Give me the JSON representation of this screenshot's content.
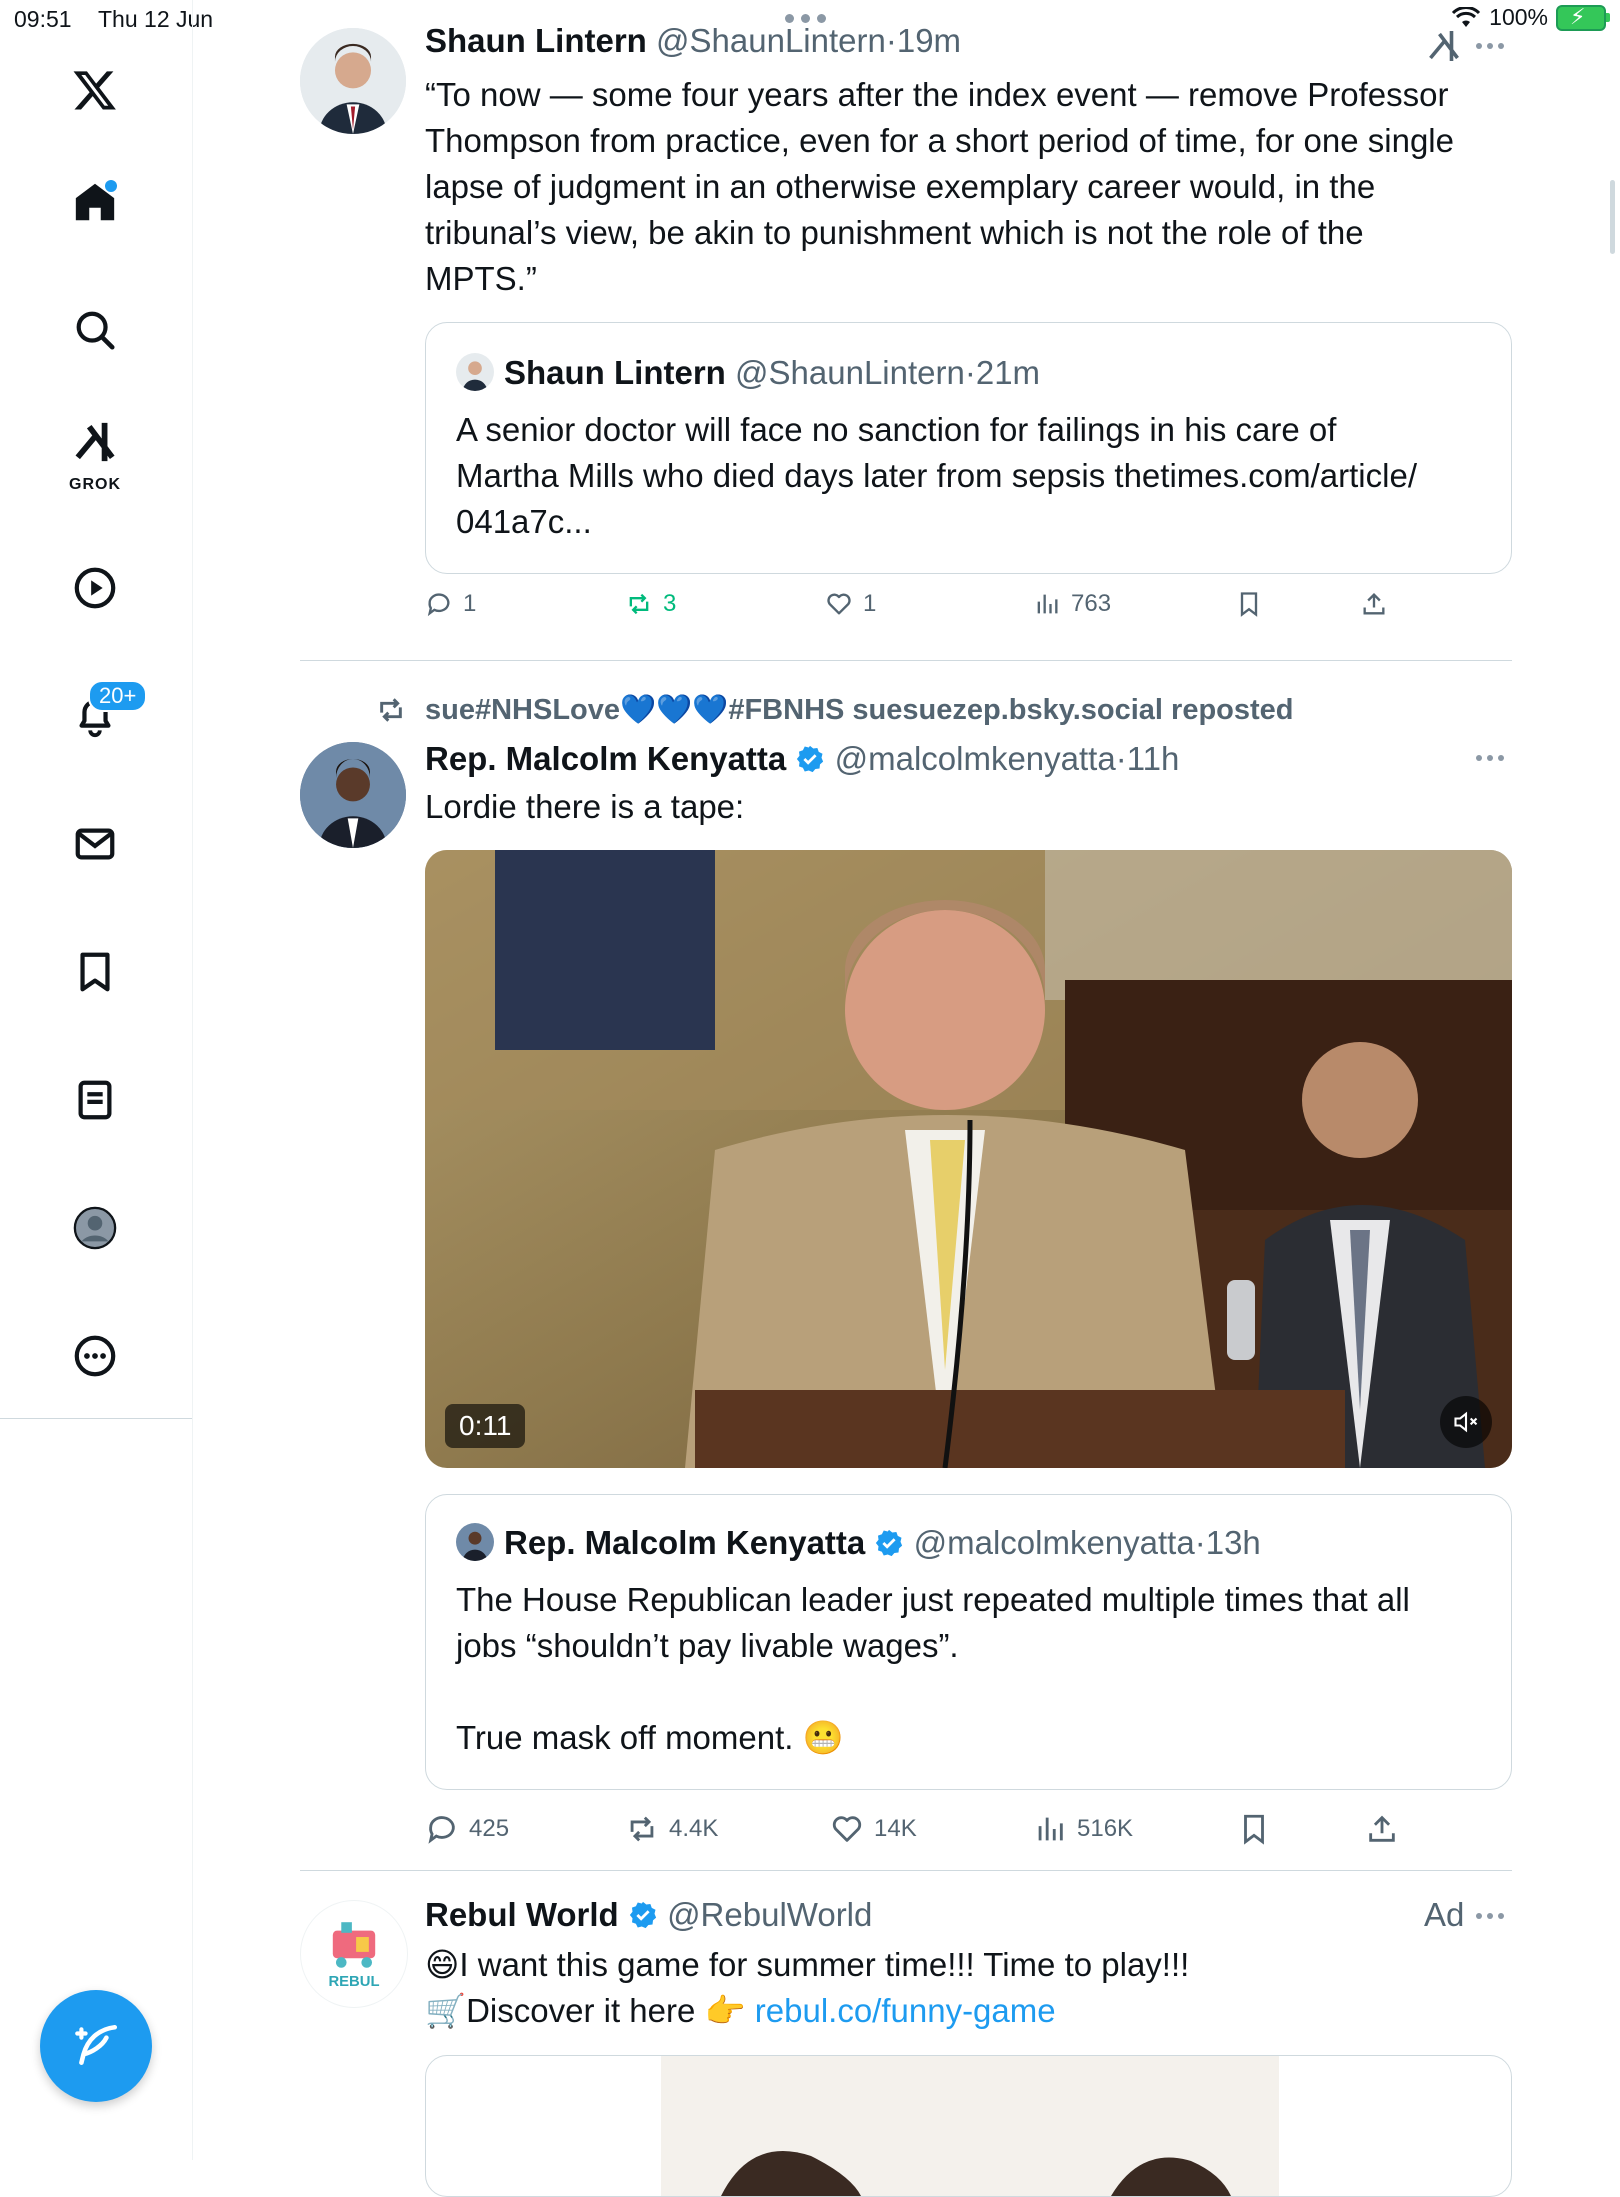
{
  "status_bar": {
    "time": "09:51",
    "date": "Thu 12 Jun",
    "battery": "100%"
  },
  "sidebar": {
    "items": [
      {
        "name": "x-logo"
      },
      {
        "name": "home"
      },
      {
        "name": "search"
      },
      {
        "name": "grok",
        "label": "GROK"
      },
      {
        "name": "video"
      },
      {
        "name": "notifications",
        "badge": "20+"
      },
      {
        "name": "messages"
      },
      {
        "name": "bookmarks"
      },
      {
        "name": "lists"
      },
      {
        "name": "profile"
      },
      {
        "name": "more"
      }
    ]
  },
  "tweets": [
    {
      "author": "Shaun Lintern",
      "handle": "@ShaunLintern",
      "time": "19m",
      "text_lines": [
        "“To now — some four years after the index event — remove Professor",
        "Thompson from practice, even for a short period of time, for one single",
        "lapse of judgment in an otherwise exemplary career would, in the",
        "tribunal’s view, be akin to punishment which is not the role of the",
        "MPTS.”"
      ],
      "quote": {
        "author": "Shaun Lintern",
        "handle": "@ShaunLintern",
        "time": "21m",
        "text_lines": [
          "A senior doctor will face no sanction for failings in his care of",
          "Martha Mills who died days later from sepsis thetimes.com/article/",
          "041a7c..."
        ]
      },
      "stats": {
        "replies": "1",
        "reposts": "3",
        "likes": "1",
        "views": "763"
      }
    },
    {
      "repost_by": "sue#NHSLove💙💙💙#FBNHS suesuezep.bsky.social reposted",
      "author": "Rep. Malcolm Kenyatta",
      "handle": "@malcolmkenyatta",
      "time": "11h",
      "text": "Lordie there is a tape:",
      "video_duration": "0:11",
      "quote": {
        "author": "Rep. Malcolm Kenyatta",
        "handle": "@malcolmkenyatta",
        "time": "13h",
        "text_lines": [
          "The House Republican leader just repeated multiple times that all",
          "jobs “shouldn’t pay livable wages”."
        ],
        "text_line3": "True mask off moment. 😬"
      },
      "stats": {
        "replies": "425",
        "reposts": "4.4K",
        "likes": "14K",
        "views": "516K"
      }
    },
    {
      "author": "Rebul World",
      "handle": "@RebulWorld",
      "ad_label": "Ad",
      "line1": "😄I want this game for summer time!!! Time to play!!!",
      "line2_prefix": "🛒Discover it here 👉 ",
      "link": "rebul.co/funny-game",
      "avatar_text": "REBUL"
    }
  ],
  "colors": {
    "accent": "#1d9bf0",
    "repost_green": "#00ba7c",
    "muted": "#536471"
  }
}
